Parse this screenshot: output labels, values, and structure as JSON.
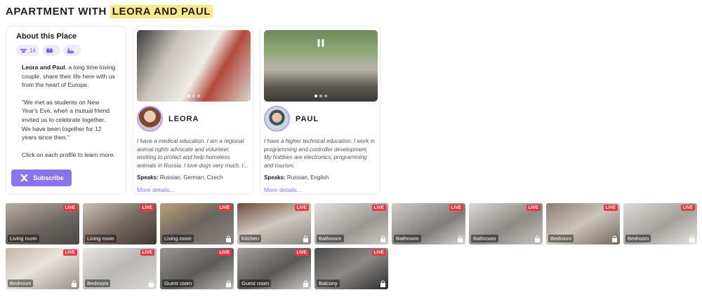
{
  "title": {
    "prefix": "APARTMENT WITH",
    "highlight": "LEORA AND PAUL"
  },
  "about": {
    "heading": "About this Place",
    "chips": [
      {
        "icon": "webcam-icon",
        "count": "14"
      },
      {
        "icon": "bed-icon",
        "count": ""
      },
      {
        "icon": "bathtub-icon",
        "count": ""
      }
    ],
    "intro_names": "Leora and Paul",
    "intro_rest": ", a long time loving couple, share their life here with us from the heart of Europe.",
    "quote": "\"We met as students on New Year's Eve, when a mutual friend invited us to celebrate together. We have been together for 12 years since then.\"",
    "hint": "Click on each profile to learn more.",
    "subscribe_label": "Subscribe"
  },
  "profiles": [
    {
      "name": "LEORA",
      "bio": "I have a medical education. I am a regional animal rights advocate and volunteer, working to protect and help homeless animals in Russia. I love dogs very much. I...",
      "speaks_label": "Speaks:",
      "speaks": "Russian, German, Czech",
      "more": "More details..."
    },
    {
      "name": "PAUL",
      "bio": "I have a higher technical education. I work in programming and controller development. My hobbies are electronics, programming and tourism.",
      "speaks_label": "Speaks:",
      "speaks": "Russian, English",
      "more": "More details..."
    }
  ],
  "live_badge": "LIVE",
  "rooms": [
    {
      "label": "Living room",
      "locked": false
    },
    {
      "label": "Living room",
      "locked": false
    },
    {
      "label": "Living room",
      "locked": true
    },
    {
      "label": "Kitchen",
      "locked": true
    },
    {
      "label": "Bathroom",
      "locked": true
    },
    {
      "label": "Bathroom",
      "locked": true
    },
    {
      "label": "Bathroom",
      "locked": true
    },
    {
      "label": "Bedroom",
      "locked": true
    },
    {
      "label": "Bedroom",
      "locked": true
    },
    {
      "label": "Bedroom",
      "locked": true
    },
    {
      "label": "Bedroom",
      "locked": true
    },
    {
      "label": "Guest room",
      "locked": true
    },
    {
      "label": "Guest room",
      "locked": true
    },
    {
      "label": "Balcony",
      "locked": true
    }
  ]
}
